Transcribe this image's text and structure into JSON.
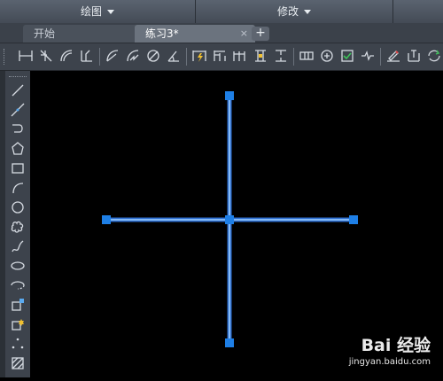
{
  "ribbon": {
    "panels": [
      {
        "label": "绘图"
      },
      {
        "label": "修改"
      }
    ]
  },
  "tabs": [
    {
      "label": "开始",
      "active": false
    },
    {
      "label": "练习3*",
      "active": true,
      "close": "×"
    }
  ],
  "new_tab_symbol": "+",
  "dimension_toolbar": {
    "icons": [
      "linear-dimension-icon",
      "aligned-dimension-icon",
      "arc-length-icon",
      "ordinate-dimension-icon",
      "radius-dimension-icon",
      "jogged-radius-icon",
      "diameter-dimension-icon",
      "angular-dimension-icon",
      "quick-dimension-icon",
      "baseline-dimension-icon",
      "continue-dimension-icon",
      "dimension-space-icon",
      "dimension-break-icon",
      "tolerance-icon",
      "center-mark-icon",
      "inspection-icon",
      "jogged-linear-icon",
      "dimension-edit-icon",
      "dimension-text-edit-icon",
      "dimension-update-icon"
    ]
  },
  "draw_toolbar": {
    "icons": [
      "line-icon",
      "construction-line-icon",
      "polyline-icon",
      "polygon-icon",
      "rectangle-icon",
      "arc-icon",
      "circle-icon",
      "revision-cloud-icon",
      "spline-icon",
      "ellipse-icon",
      "ellipse-arc-icon",
      "insert-block-icon",
      "make-block-icon",
      "point-icon",
      "hatch-icon"
    ]
  },
  "drawing": {
    "line_color": "#9fd0ff",
    "grip_color": "#1e7fe6",
    "background": "#000000"
  },
  "watermark": {
    "brand": "Bai 经验",
    "url": "jingyan.baidu.com"
  }
}
